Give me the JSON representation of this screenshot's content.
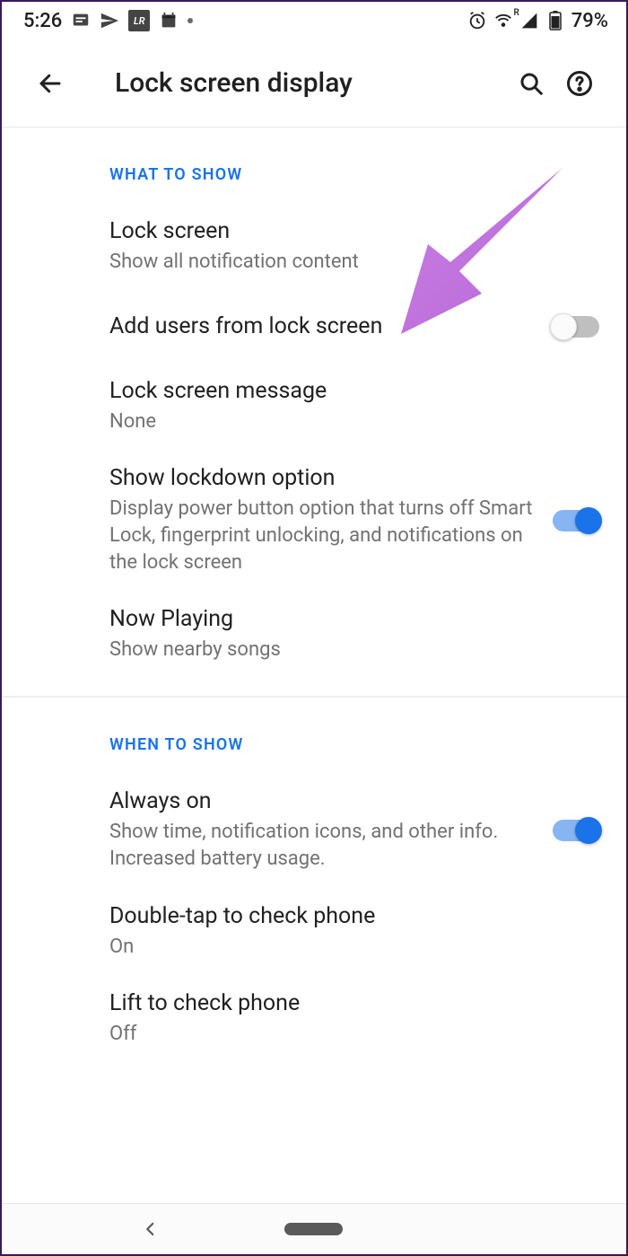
{
  "status": {
    "time": "5:26",
    "battery": "79%",
    "wifi_super": "R"
  },
  "header": {
    "title": "Lock screen display"
  },
  "sections": [
    {
      "header": "WHAT TO SHOW",
      "items": [
        {
          "title": "Lock screen",
          "sub": "Show all notification content"
        },
        {
          "title": "Add users from lock screen",
          "toggle": "off"
        },
        {
          "title": "Lock screen message",
          "sub": "None"
        },
        {
          "title": "Show lockdown option",
          "sub": "Display power button option that turns off Smart Lock, fingerprint unlocking, and notifications on the lock screen",
          "toggle": "on"
        },
        {
          "title": "Now Playing",
          "sub": "Show nearby songs"
        }
      ]
    },
    {
      "header": "WHEN TO SHOW",
      "items": [
        {
          "title": "Always on",
          "sub": "Show time, notification icons, and other info. Increased battery usage.",
          "toggle": "on"
        },
        {
          "title": "Double-tap to check phone",
          "sub": "On"
        },
        {
          "title": "Lift to check phone",
          "sub": "Off"
        }
      ]
    }
  ]
}
